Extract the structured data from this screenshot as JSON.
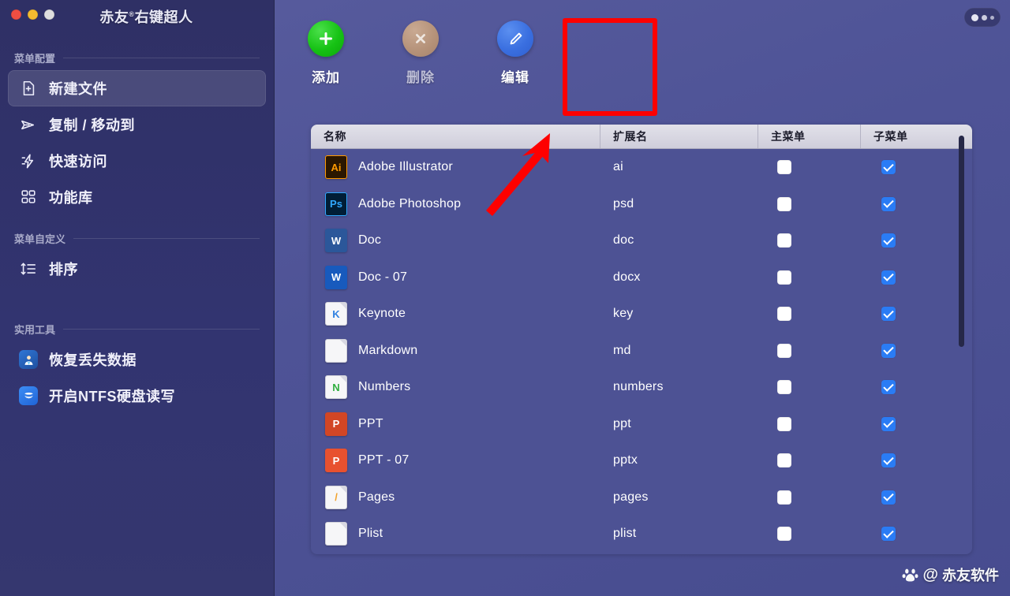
{
  "window": {
    "title": "赤友®右键超人",
    "title_main": "赤友",
    "title_reg": "®",
    "title_rest": "右键超人",
    "traffic_lights": [
      "close",
      "minimize",
      "zoom"
    ],
    "more_button": "more-options"
  },
  "sidebar": {
    "sections": [
      {
        "label": "菜单配置",
        "items": [
          {
            "label": "新建文件",
            "icon": "new-file-icon",
            "active": true
          },
          {
            "label": "复制 / 移动到",
            "icon": "send-arrow-icon",
            "active": false
          },
          {
            "label": "快速访问",
            "icon": "lightning-icon",
            "active": false
          },
          {
            "label": "功能库",
            "icon": "grid-icon",
            "active": false
          }
        ]
      },
      {
        "label": "菜单自定义",
        "items": [
          {
            "label": "排序",
            "icon": "sort-icon",
            "active": false
          }
        ]
      },
      {
        "label": "实用工具",
        "items": [
          {
            "label": "恢复丢失数据",
            "icon": "data-recovery-app-icon",
            "active": false
          },
          {
            "label": "开启NTFS硬盘读写",
            "icon": "ntfs-app-icon",
            "active": false
          }
        ]
      }
    ]
  },
  "toolbar": {
    "buttons": [
      {
        "label": "添加",
        "icon": "plus-circle-icon",
        "state": "enabled",
        "color": "#16c214"
      },
      {
        "label": "删除",
        "icon": "close-circle-icon",
        "state": "disabled",
        "color": "#b49178"
      },
      {
        "label": "编辑",
        "icon": "pencil-circle-icon",
        "state": "enabled",
        "color": "#3a6fe0"
      }
    ]
  },
  "table": {
    "columns": [
      "名称",
      "扩展名",
      "主菜单",
      "子菜单"
    ],
    "rows": [
      {
        "name": "Adobe Illustrator",
        "ext": "ai",
        "main_menu": false,
        "sub_menu": true,
        "icon": "illustrator-icon",
        "glyph": "Ai",
        "bg": "#2b1700",
        "fg": "#ff9a00",
        "border": "#ff9a00"
      },
      {
        "name": "Adobe Photoshop",
        "ext": "psd",
        "main_menu": false,
        "sub_menu": true,
        "icon": "photoshop-icon",
        "glyph": "Ps",
        "bg": "#001e36",
        "fg": "#31a8ff",
        "border": "#31a8ff"
      },
      {
        "name": "Doc",
        "ext": "doc",
        "main_menu": false,
        "sub_menu": true,
        "icon": "word-doc-icon",
        "glyph": "W",
        "bg": "#2b579a",
        "fg": "#ffffff",
        "border": "#2b579a"
      },
      {
        "name": "Doc - 07",
        "ext": "docx",
        "main_menu": false,
        "sub_menu": true,
        "icon": "word-docx-icon",
        "glyph": "W",
        "bg": "#185abd",
        "fg": "#ffffff",
        "border": "#185abd"
      },
      {
        "name": "Keynote",
        "ext": "key",
        "main_menu": false,
        "sub_menu": true,
        "icon": "keynote-icon",
        "glyph": "K",
        "bg": "#f6f6f8",
        "fg": "#2e7fe0",
        "border": "#cfcfd8"
      },
      {
        "name": "Markdown",
        "ext": "md",
        "main_menu": false,
        "sub_menu": true,
        "icon": "markdown-icon",
        "glyph": "",
        "bg": "#f6f6f8",
        "fg": "#8a8a99",
        "border": "#cfcfd8"
      },
      {
        "name": "Numbers",
        "ext": "numbers",
        "main_menu": false,
        "sub_menu": true,
        "icon": "numbers-icon",
        "glyph": "N",
        "bg": "#f6f6f8",
        "fg": "#2fae3f",
        "border": "#cfcfd8"
      },
      {
        "name": "PPT",
        "ext": "ppt",
        "main_menu": false,
        "sub_menu": true,
        "icon": "powerpoint-icon",
        "glyph": "P",
        "bg": "#d24625",
        "fg": "#ffffff",
        "border": "#d24625"
      },
      {
        "name": "PPT - 07",
        "ext": "pptx",
        "main_menu": false,
        "sub_menu": true,
        "icon": "powerpointx-icon",
        "glyph": "P",
        "bg": "#e8512f",
        "fg": "#ffffff",
        "border": "#e8512f"
      },
      {
        "name": "Pages",
        "ext": "pages",
        "main_menu": false,
        "sub_menu": true,
        "icon": "pages-icon",
        "glyph": "/",
        "bg": "#f6f6f8",
        "fg": "#f2a12b",
        "border": "#cfcfd8"
      },
      {
        "name": "Plist",
        "ext": "plist",
        "main_menu": false,
        "sub_menu": true,
        "icon": "plist-icon",
        "glyph": "",
        "bg": "#f6f6f8",
        "fg": "#8a8a99",
        "border": "#cfcfd8"
      }
    ],
    "partial_row_visible": true,
    "scrollbar": {
      "orientation": "vertical",
      "thumb_fraction": 0.55
    }
  },
  "annotations": {
    "highlight_rect": {
      "target": "添加",
      "color": "#fe0000"
    },
    "arrow": {
      "points_to": "添加",
      "color": "#fe0000"
    }
  },
  "watermark": {
    "at": "@",
    "text": "赤友软件",
    "icon": "baidu-paw-icon"
  },
  "colors": {
    "sidebar_bg": "#2f3065",
    "main_bg": "#4e5396",
    "table_bg": "#4d5294",
    "header_bg": "#d4d3dc",
    "accent_checked": "#2a7cf5",
    "annotation_red": "#fe0000"
  }
}
